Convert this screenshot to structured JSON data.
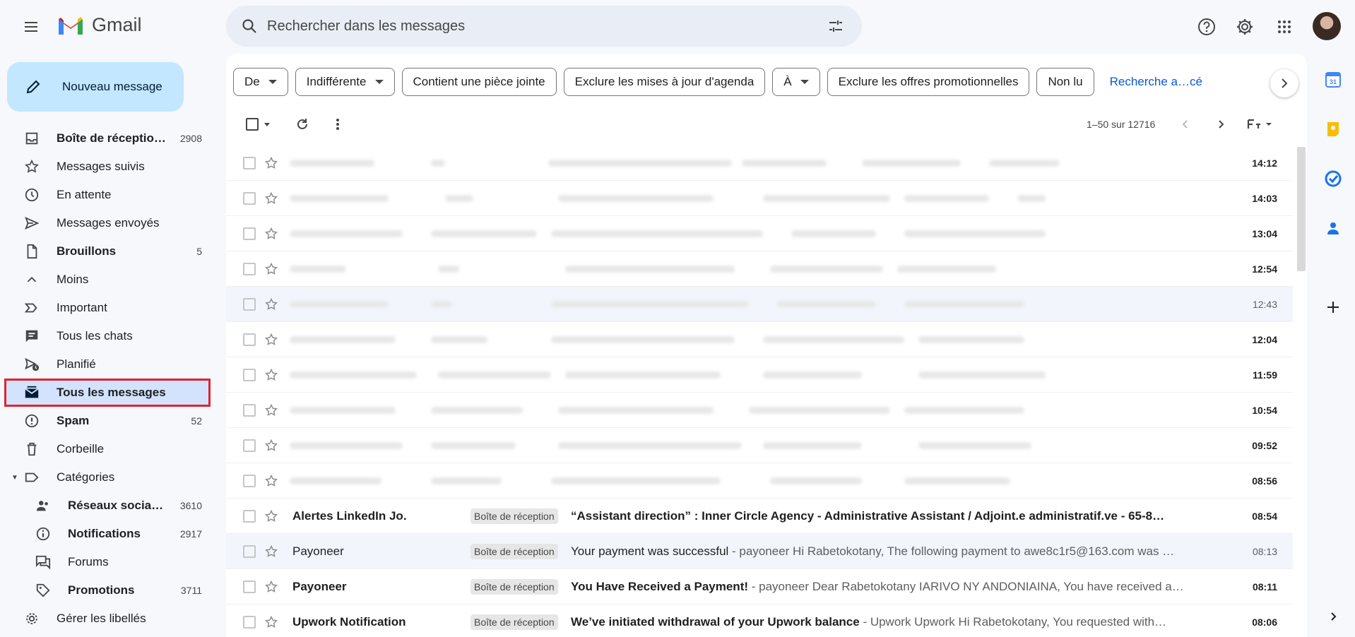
{
  "app": {
    "name": "Gmail"
  },
  "search": {
    "placeholder": "Rechercher dans les messages"
  },
  "compose": {
    "label": "Nouveau message"
  },
  "sidebar": {
    "items": [
      {
        "label": "Boîte de réceptio…",
        "count": "2908",
        "icon": "inbox-icon",
        "bold": true
      },
      {
        "label": "Messages suivis",
        "count": "",
        "icon": "star-icon"
      },
      {
        "label": "En attente",
        "count": "",
        "icon": "clock-icon"
      },
      {
        "label": "Messages envoyés",
        "count": "",
        "icon": "send-icon"
      },
      {
        "label": "Brouillons",
        "count": "5",
        "icon": "draft-icon",
        "bold": true
      },
      {
        "label": "Moins",
        "count": "",
        "icon": "chevron-up-icon"
      },
      {
        "label": "Important",
        "count": "",
        "icon": "important-icon"
      },
      {
        "label": "Tous les chats",
        "count": "",
        "icon": "chat-icon"
      },
      {
        "label": "Planifié",
        "count": "",
        "icon": "scheduled-icon"
      },
      {
        "label": "Tous les messages",
        "count": "",
        "icon": "all-mail-icon",
        "active": true
      },
      {
        "label": "Spam",
        "count": "52",
        "icon": "spam-icon",
        "bold": true
      },
      {
        "label": "Corbeille",
        "count": "",
        "icon": "trash-icon"
      },
      {
        "label": "Catégories",
        "count": "",
        "icon": "label-icon"
      },
      {
        "label": "Réseaux socia…",
        "count": "3610",
        "icon": "social-icon",
        "bold": true,
        "sub": true
      },
      {
        "label": "Notifications",
        "count": "2917",
        "icon": "info-icon",
        "bold": true,
        "sub": true
      },
      {
        "label": "Forums",
        "count": "",
        "icon": "forum-icon",
        "sub": true
      },
      {
        "label": "Promotions",
        "count": "3711",
        "icon": "tag-icon",
        "bold": true,
        "sub": true
      },
      {
        "label": "Gérer les libellés",
        "count": "",
        "icon": "gear-icon"
      }
    ]
  },
  "filters": {
    "chips": [
      "De",
      "Indifférente",
      "Contient une pièce jointe",
      "Exclure les mises à jour d'agenda",
      "À",
      "Exclure les offres promotionnelles",
      "Non lu"
    ],
    "advanced": "Recherche a…cé"
  },
  "toolbar": {
    "pager": "1–50 sur 12716"
  },
  "emails": [
    {
      "time": "14:12",
      "blurred": true,
      "unread": true
    },
    {
      "time": "14:03",
      "blurred": true,
      "unread": true
    },
    {
      "time": "13:04",
      "blurred": true,
      "unread": true
    },
    {
      "time": "12:54",
      "blurred": true,
      "unread": true
    },
    {
      "time": "12:43",
      "blurred": true,
      "unread": false,
      "highlight": true
    },
    {
      "time": "12:04",
      "blurred": true,
      "unread": true
    },
    {
      "time": "11:59",
      "blurred": true,
      "unread": true
    },
    {
      "time": "10:54",
      "blurred": true,
      "unread": true
    },
    {
      "time": "09:52",
      "blurred": true,
      "unread": true
    },
    {
      "time": "08:56",
      "blurred": true,
      "unread": true
    },
    {
      "sender": "Alertes LinkedIn Jo.",
      "label": "Boîte de réception",
      "subject": "“Assistant direction” : Inner Circle Agency - Administrative Assistant / Adjoint.e administratif.ve - 65-8…",
      "snippet": "",
      "time": "08:54",
      "unread": true
    },
    {
      "sender": "Payoneer",
      "label": "Boîte de réception",
      "subject": "Your payment was successful",
      "snippet": " - payoneer Hi Rabetokotany, The following payment to awe8c1r5@163.com was …",
      "time": "08:13",
      "unread": false,
      "highlight": true
    },
    {
      "sender": "Payoneer",
      "label": "Boîte de réception",
      "subject": "You Have Received a Payment!",
      "snippet": " - payoneer Dear Rabetokotany IARIVO NY ANDONIAINA, You have received a…",
      "time": "08:11",
      "unread": true
    },
    {
      "sender": "Upwork Notification",
      "label": "Boîte de réception",
      "subject": "We’ve initiated withdrawal of your Upwork balance",
      "snippet": " - Upwork Upwork Hi Rabetokotany, You requested with…",
      "time": "08:06",
      "unread": true
    }
  ]
}
